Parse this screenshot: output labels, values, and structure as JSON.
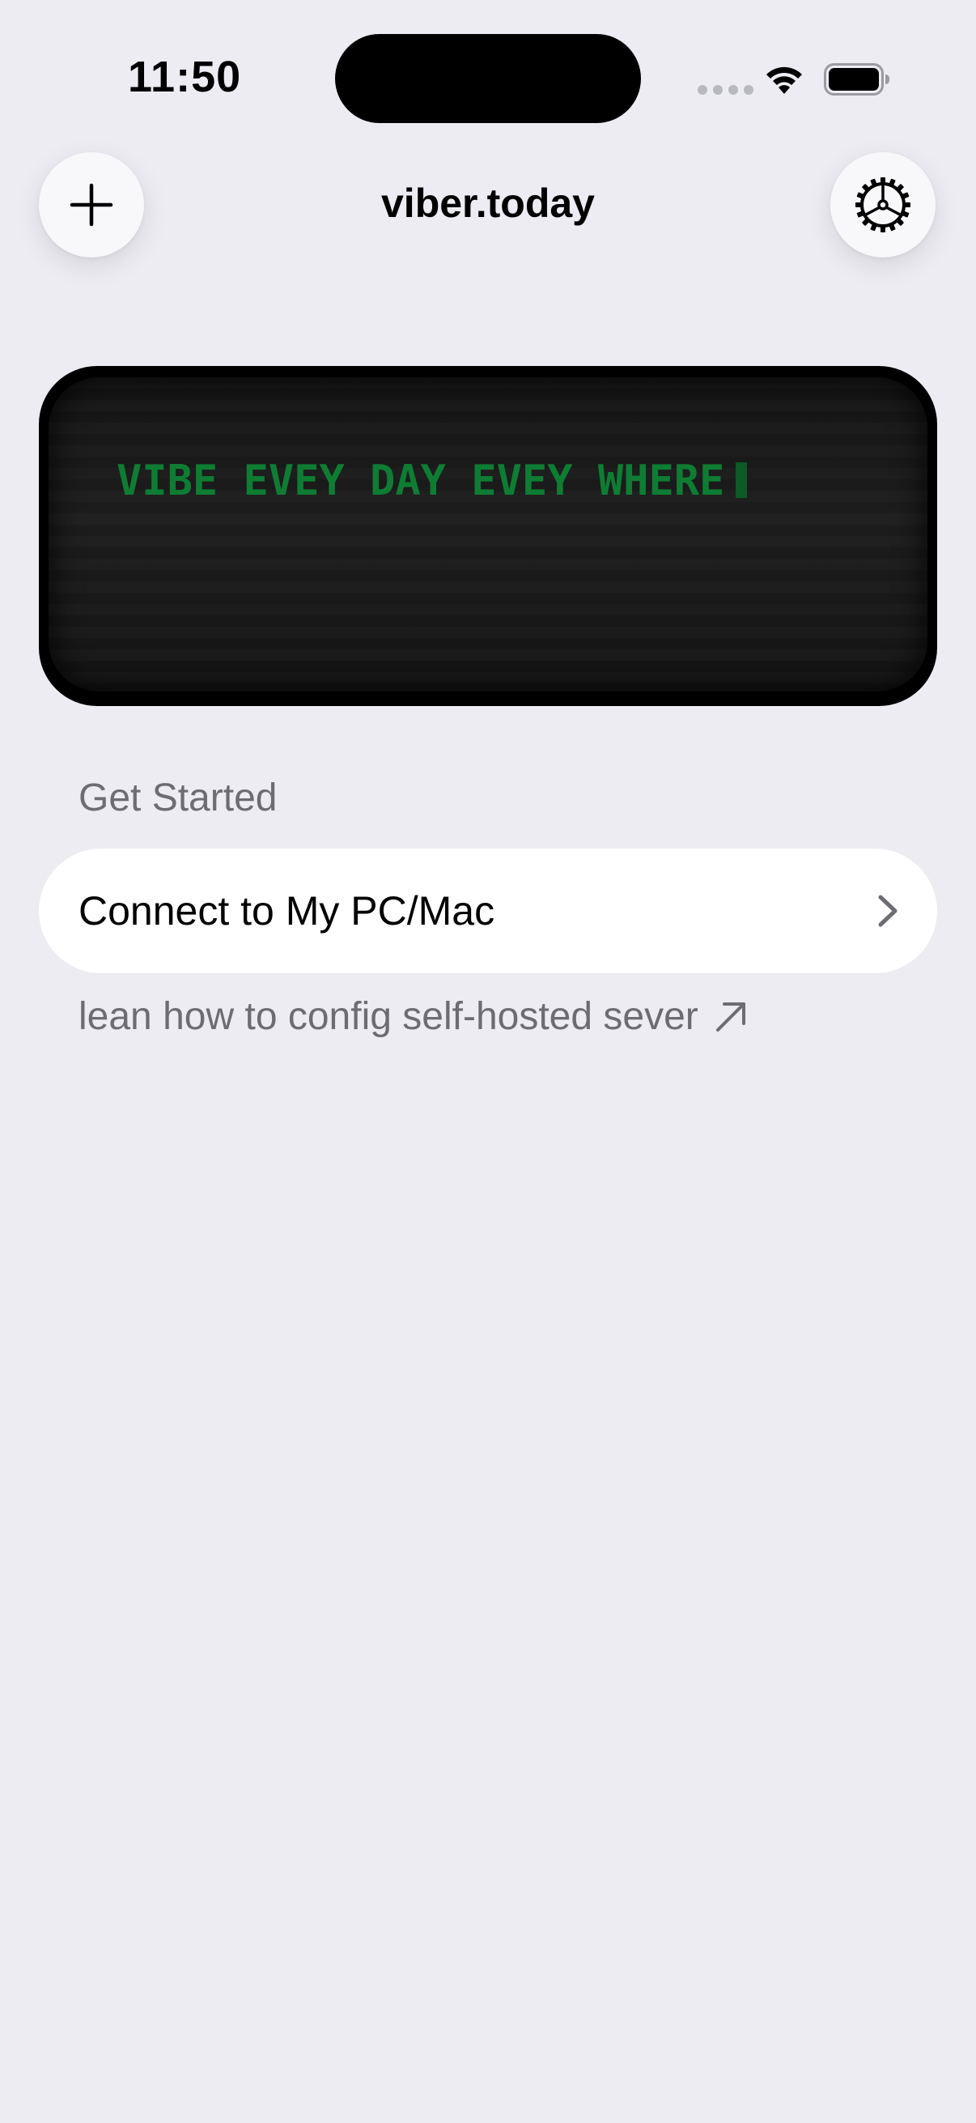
{
  "status_bar": {
    "time": "11:50",
    "icons": [
      "signal-icon",
      "wifi-icon",
      "battery-icon"
    ]
  },
  "nav": {
    "title": "viber.today",
    "left_icon": "plus-icon",
    "right_icon": "gear-icon"
  },
  "banner": {
    "text": "VIBE EVEY DAY EVEY WHERE",
    "text_color": "#0e7d33"
  },
  "get_started": {
    "header": "Get Started",
    "rows": [
      {
        "label": "Connect to My PC/Mac",
        "icon": "chevron-right-icon"
      }
    ],
    "help_link": "lean how to config self-hosted sever",
    "help_icon": "arrow-up-right-icon"
  },
  "colors": {
    "background": "#ececf2",
    "card": "#ffffff",
    "secondary_text": "#6c6c72",
    "terminal_green": "#0e7d33"
  }
}
